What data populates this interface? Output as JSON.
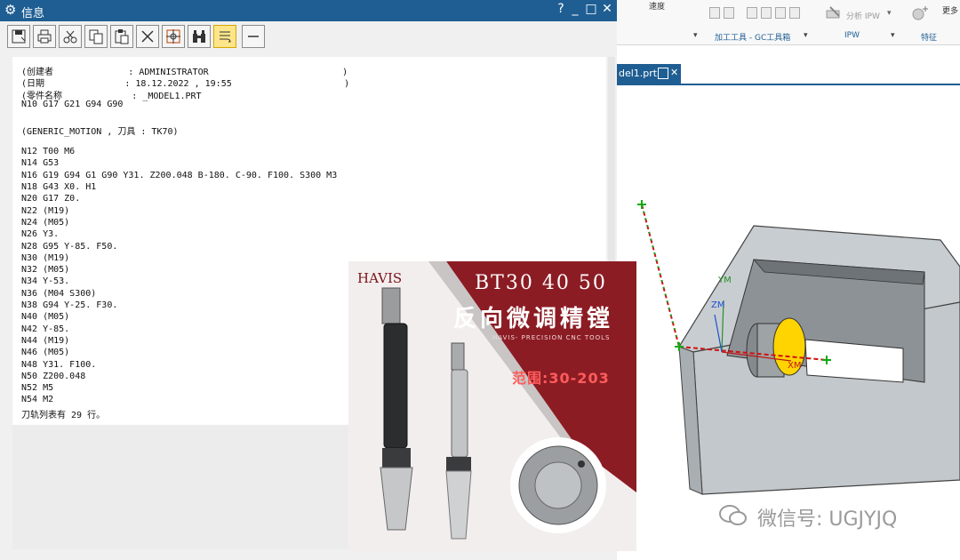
{
  "info_window": {
    "title": "信息",
    "controls": {
      "help": "?",
      "minimize": "_",
      "maximize": "□",
      "close": "✕"
    },
    "toolbar_icons": [
      "save-icon",
      "print-icon",
      "cut-icon",
      "copy-icon",
      "paste-icon",
      "delete-icon",
      "find-icon",
      "binoculars-icon",
      "wrap-icon",
      "minus-icon"
    ],
    "lines": [
      "(创建者              : ADMINISTRATOR                         )",
      "(日期               : 18.12.2022 , 19:55                     )",
      "(零件名称             : _MODEL1.PRT",
      "N10 G17 G21 G94 G90",
      "",
      "(GENERIC_MOTION , 刀具 : TK70)",
      "",
      "N12 T00 M6",
      "N14 G53",
      "N16 G19 G94 G1 G90 Y31. Z200.048 B-180. C-90. F100. S300 M3",
      "N18 G43 X0. H1",
      "N20 G17 Z0.",
      "N22 (M19)",
      "N24 (M05)",
      "N26 Y3.",
      "N28 G95 Y-85. F50.",
      "N30 (M19)",
      "N32 (M05)",
      "N34 Y-53.",
      "N36 (M04 S300)",
      "N38 G94 Y-25. F30.",
      "N40 (M05)",
      "N42 Y-85.",
      "N44 (M19)",
      "N46 (M05)",
      "N48 Y31. F100.",
      "N50 Z200.048",
      "N52 M5",
      "N54 M2",
      "刀轨列表有 29 行。"
    ]
  },
  "nx": {
    "ribbon": {
      "speed_label": "速度",
      "analyze_ipw": "分析 IPW",
      "more": "更多",
      "groups": [
        "加工工具 - GC工具箱",
        "IPW",
        "特征"
      ]
    },
    "tab": {
      "label": "del1.prt",
      "close": "✕"
    },
    "axes": {
      "ym": "YM",
      "zm": "ZM",
      "xm": "XM"
    }
  },
  "promo": {
    "brand": "HAVIS",
    "headline": "BT30 40 50",
    "subhead": "反向微调精镗",
    "tagline": "HAVIS- PRECISION CNC TOOLS",
    "range_label": "范围:30-203",
    "colors": {
      "crimson": "#8c1c24",
      "pale": "#f3eeee"
    }
  },
  "watermark": {
    "text": "微信号: UGJYJQ"
  }
}
